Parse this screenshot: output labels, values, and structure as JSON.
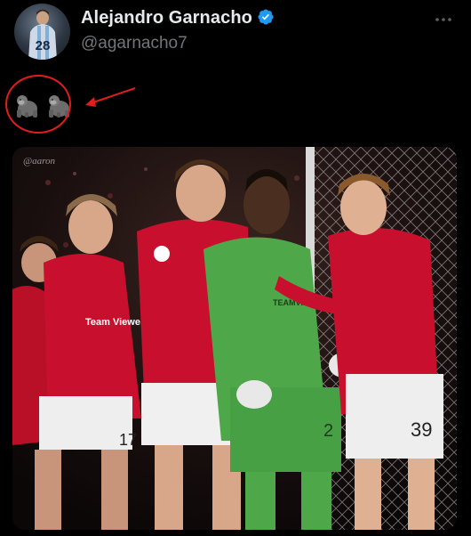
{
  "author": {
    "display_name": "Alejandro Garnacho",
    "handle": "@agarnacho7",
    "avatar_icon": "player-avatar",
    "avatar_shirt_number": "28",
    "verified_icon": "verified-badge-icon",
    "verified_color": "#1d9bf0"
  },
  "menu": {
    "icon": "more-options-icon"
  },
  "tweet": {
    "emoji_icons": [
      "gorilla-icon",
      "gorilla-icon"
    ]
  },
  "annotation": {
    "color": "#e01c1c",
    "shapes": [
      "red-circle",
      "red-arrow"
    ]
  },
  "media": {
    "description_icon": "team-celebration-photo",
    "watermark": "@aaron",
    "shirt_numbers": [
      "17",
      "2",
      "39"
    ],
    "sponsor_text": "Team Viewer",
    "goalkeeper_sponsor": "TEAMVIEWER",
    "kit_colors": {
      "home": "#c8102e",
      "goalkeeper": "#4ea84a",
      "shorts": "#eeeeee"
    }
  }
}
